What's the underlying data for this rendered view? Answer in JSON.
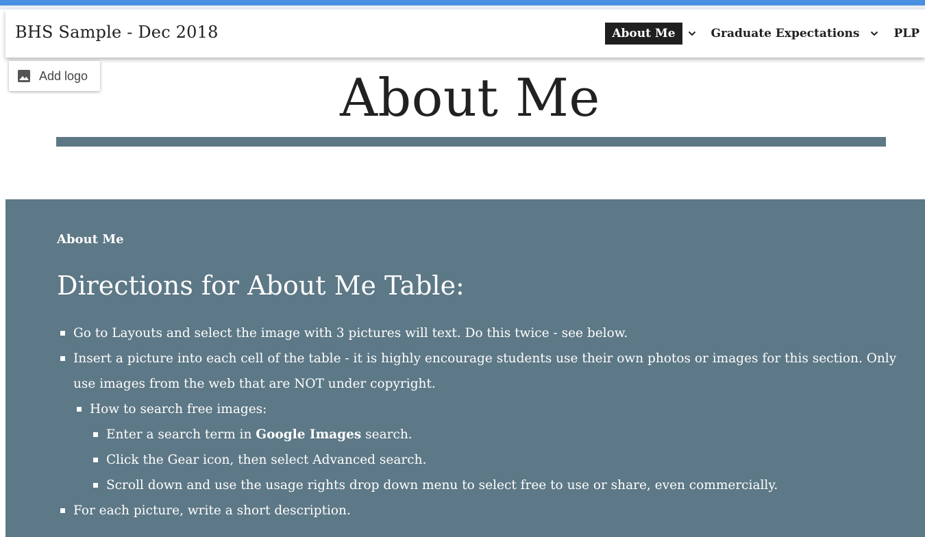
{
  "site": {
    "title": "BHS Sample - Dec 2018"
  },
  "nav": {
    "items": [
      {
        "label": "About Me",
        "active": true
      },
      {
        "label": "Graduate Expectations",
        "active": false
      },
      {
        "label": "PLP",
        "active": false
      }
    ]
  },
  "logo": {
    "label": "Add logo",
    "icon": "image-icon"
  },
  "page": {
    "title": "About Me"
  },
  "section": {
    "label": "About Me",
    "heading": "Directions for About Me Table:",
    "items": [
      {
        "level": 1,
        "text": "Go to Layouts and select the image with 3 pictures will text. Do this twice - see below."
      },
      {
        "level": 1,
        "text": "Insert a picture into each cell of the table - it is highly encourage students use their own photos or images for this section. Only use images from the web that are NOT under copyright."
      },
      {
        "level": 2,
        "text": "How to search free images:"
      },
      {
        "level": 3,
        "pre": "Enter a search term in ",
        "bold": "Google Images",
        "post": " search."
      },
      {
        "level": 3,
        "text": "Click the Gear icon, then select Advanced search."
      },
      {
        "level": 3,
        "text": "Scroll down and use the usage rights drop down menu to select free to use or share, even commercially."
      },
      {
        "level": 1,
        "text": "For each picture, write a short description."
      }
    ]
  },
  "colors": {
    "top_bar": "#4a90e2",
    "section_bg": "#5d7886",
    "rule": "#5e7785",
    "active_nav_bg": "#1f1f1f"
  }
}
